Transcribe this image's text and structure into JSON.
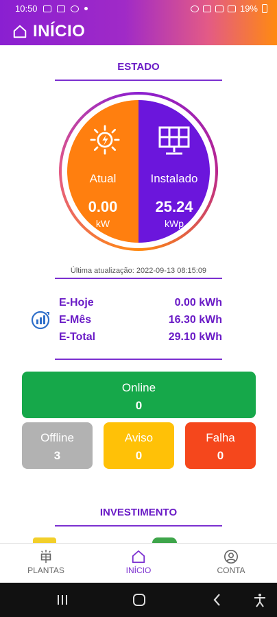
{
  "status_bar": {
    "time": "10:50",
    "battery": "19%"
  },
  "app_bar": {
    "title": "INÍCIO",
    "icon": "home-icon"
  },
  "estado": {
    "title": "ESTADO",
    "atual": {
      "label": "Atual",
      "value": "0.00",
      "unit": "kW",
      "icon": "sun-icon"
    },
    "instalado": {
      "label": "Instalado",
      "value": "25.24",
      "unit": "kWp",
      "icon": "solar-panel-icon"
    },
    "last_update": "Última atualização: 2022-09-13 08:15:09",
    "colors": {
      "atual": "#ff7f0f",
      "instalado": "#6b16dc"
    }
  },
  "energy": {
    "icon": "energy-chart-icon",
    "rows": [
      {
        "label": "E-Hoje",
        "value": "0.00 kWh"
      },
      {
        "label": "E-Mês",
        "value": "16.30 kWh"
      },
      {
        "label": "E-Total",
        "value": "29.10 kWh"
      }
    ]
  },
  "plants_status": {
    "online": {
      "label": "Online",
      "count": "0",
      "color": "#16a84a"
    },
    "offline": {
      "label": "Offline",
      "count": "3",
      "color": "#b2b2b2"
    },
    "aviso": {
      "label": "Aviso",
      "count": "0",
      "color": "#ffc107"
    },
    "falha": {
      "label": "Falha",
      "count": "0",
      "color": "#f5471c"
    }
  },
  "investimento": {
    "title": "INVESTIMENTO"
  },
  "bottom_nav": {
    "items": [
      {
        "label": "PLANTAS",
        "icon": "plant-icon"
      },
      {
        "label": "INÍCIO",
        "icon": "home-icon",
        "active": true
      },
      {
        "label": "CONTA",
        "icon": "account-icon"
      }
    ]
  }
}
